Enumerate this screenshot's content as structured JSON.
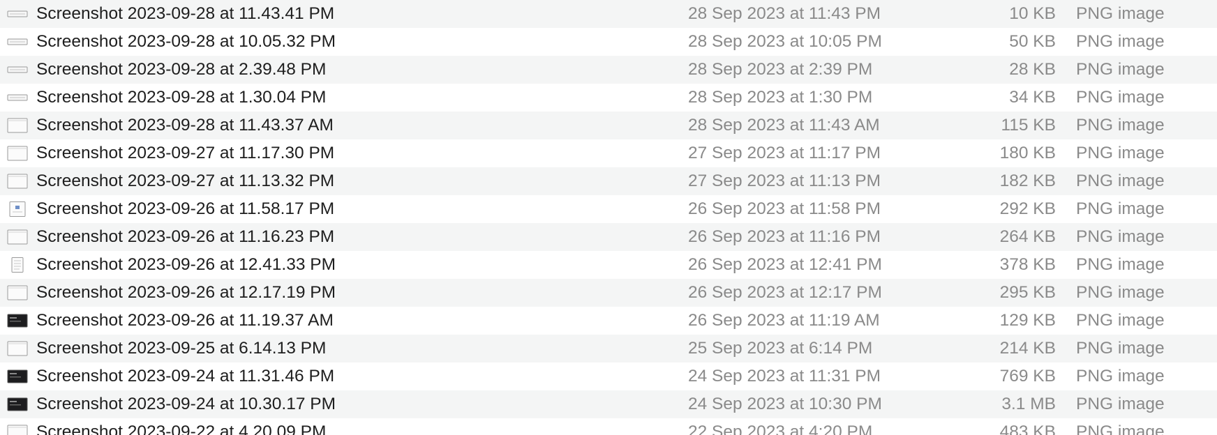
{
  "files": [
    {
      "name": "Screenshot 2023-09-28 at 11.43.41 PM",
      "date": "28 Sep 2023 at 11:43 PM",
      "size": "10 KB",
      "kind": "PNG image",
      "icon": "thumb-strip-icon"
    },
    {
      "name": "Screenshot 2023-09-28 at 10.05.32 PM",
      "date": "28 Sep 2023 at 10:05 PM",
      "size": "50 KB",
      "kind": "PNG image",
      "icon": "thumb-strip-icon"
    },
    {
      "name": "Screenshot 2023-09-28 at 2.39.48 PM",
      "date": "28 Sep 2023 at 2:39 PM",
      "size": "28 KB",
      "kind": "PNG image",
      "icon": "thumb-strip-icon"
    },
    {
      "name": "Screenshot 2023-09-28 at 1.30.04 PM",
      "date": "28 Sep 2023 at 1:30 PM",
      "size": "34 KB",
      "kind": "PNG image",
      "icon": "thumb-strip-icon"
    },
    {
      "name": "Screenshot 2023-09-28 at 11.43.37 AM",
      "date": "28 Sep 2023 at 11:43 AM",
      "size": "115 KB",
      "kind": "PNG image",
      "icon": "thumb-window-icon"
    },
    {
      "name": "Screenshot 2023-09-27 at 11.17.30 PM",
      "date": "27 Sep 2023 at 11:17 PM",
      "size": "180 KB",
      "kind": "PNG image",
      "icon": "thumb-window-icon"
    },
    {
      "name": "Screenshot 2023-09-27 at 11.13.32 PM",
      "date": "27 Sep 2023 at 11:13 PM",
      "size": "182 KB",
      "kind": "PNG image",
      "icon": "thumb-window-icon"
    },
    {
      "name": "Screenshot 2023-09-26 at 11.58.17 PM",
      "date": "26 Sep 2023 at 11:58 PM",
      "size": "292 KB",
      "kind": "PNG image",
      "icon": "thumb-document-icon"
    },
    {
      "name": "Screenshot 2023-09-26 at 11.16.23 PM",
      "date": "26 Sep 2023 at 11:16 PM",
      "size": "264 KB",
      "kind": "PNG image",
      "icon": "thumb-window-icon"
    },
    {
      "name": "Screenshot 2023-09-26 at 12.41.33 PM",
      "date": "26 Sep 2023 at 12:41 PM",
      "size": "378 KB",
      "kind": "PNG image",
      "icon": "thumb-page-icon"
    },
    {
      "name": "Screenshot 2023-09-26 at 12.17.19 PM",
      "date": "26 Sep 2023 at 12:17 PM",
      "size": "295 KB",
      "kind": "PNG image",
      "icon": "thumb-window-icon"
    },
    {
      "name": "Screenshot 2023-09-26 at 11.19.37 AM",
      "date": "26 Sep 2023 at 11:19 AM",
      "size": "129 KB",
      "kind": "PNG image",
      "icon": "thumb-dark-icon"
    },
    {
      "name": "Screenshot 2023-09-25 at 6.14.13 PM",
      "date": "25 Sep 2023 at 6:14 PM",
      "size": "214 KB",
      "kind": "PNG image",
      "icon": "thumb-window-icon"
    },
    {
      "name": "Screenshot 2023-09-24 at 11.31.46 PM",
      "date": "24 Sep 2023 at 11:31 PM",
      "size": "769 KB",
      "kind": "PNG image",
      "icon": "thumb-dark-icon"
    },
    {
      "name": "Screenshot 2023-09-24 at 10.30.17 PM",
      "date": "24 Sep 2023 at 10:30 PM",
      "size": "3.1 MB",
      "kind": "PNG image",
      "icon": "thumb-dark-icon"
    },
    {
      "name": "Screenshot 2023-09-22 at 4.20.09 PM",
      "date": "22 Sep 2023 at 4:20 PM",
      "size": "483 KB",
      "kind": "PNG image",
      "icon": "thumb-window-icon"
    }
  ]
}
